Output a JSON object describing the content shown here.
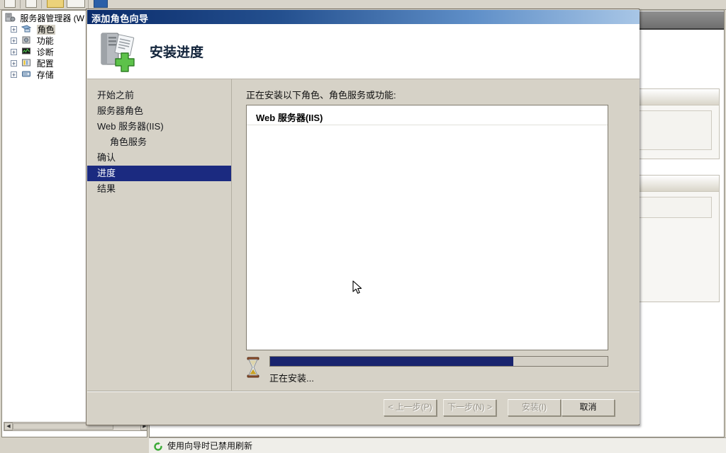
{
  "background": {
    "tree": {
      "root": {
        "label": "服务器管理器 (W",
        "icon": "server-manager-icon"
      },
      "items": [
        {
          "label": "角色",
          "icon": "roles-icon",
          "expander": "+",
          "selected": true
        },
        {
          "label": "功能",
          "icon": "features-icon",
          "expander": "+",
          "selected": false
        },
        {
          "label": "诊断",
          "icon": "diagnostics-icon",
          "expander": "+",
          "selected": false
        },
        {
          "label": "配置",
          "icon": "configuration-icon",
          "expander": "+",
          "selected": false
        },
        {
          "label": "存储",
          "icon": "storage-icon",
          "expander": "+",
          "selected": false
        }
      ]
    },
    "status": {
      "icon": "refresh-icon",
      "text": "使用向导时已禁用刷新"
    }
  },
  "wizard": {
    "title": "添加角色向导",
    "header": {
      "icon": "server-add-role-icon",
      "title": "安装进度"
    },
    "nav": {
      "items": [
        {
          "label": "开始之前",
          "indent": false,
          "active": false
        },
        {
          "label": "服务器角色",
          "indent": false,
          "active": false
        },
        {
          "label": "Web 服务器(IIS)",
          "indent": false,
          "active": false
        },
        {
          "label": "角色服务",
          "indent": true,
          "active": false
        },
        {
          "label": "确认",
          "indent": false,
          "active": false
        },
        {
          "label": "进度",
          "indent": false,
          "active": true
        },
        {
          "label": "结果",
          "indent": false,
          "active": false
        }
      ]
    },
    "body": {
      "caption": "正在安装以下角色、角色服务或功能:",
      "installing_items": [
        "Web 服务器(IIS)"
      ]
    },
    "progress": {
      "icon": "hourglass-icon",
      "percent": 72,
      "label": "正在安装..."
    },
    "buttons": [
      {
        "label": "< 上一步(P)",
        "name": "back-button",
        "disabled": true
      },
      {
        "label": "下一步(N) >",
        "name": "next-button",
        "disabled": true
      },
      {
        "label": "安装(I)",
        "name": "install-button",
        "disabled": true
      },
      {
        "label": "取消",
        "name": "cancel-button",
        "disabled": false
      }
    ]
  },
  "colors": {
    "titlebar_start": "#0b2c6b",
    "nav_active_bg": "#1b2a80",
    "progress_fill": "#19246e",
    "dialog_face": "#d6d2c7"
  }
}
